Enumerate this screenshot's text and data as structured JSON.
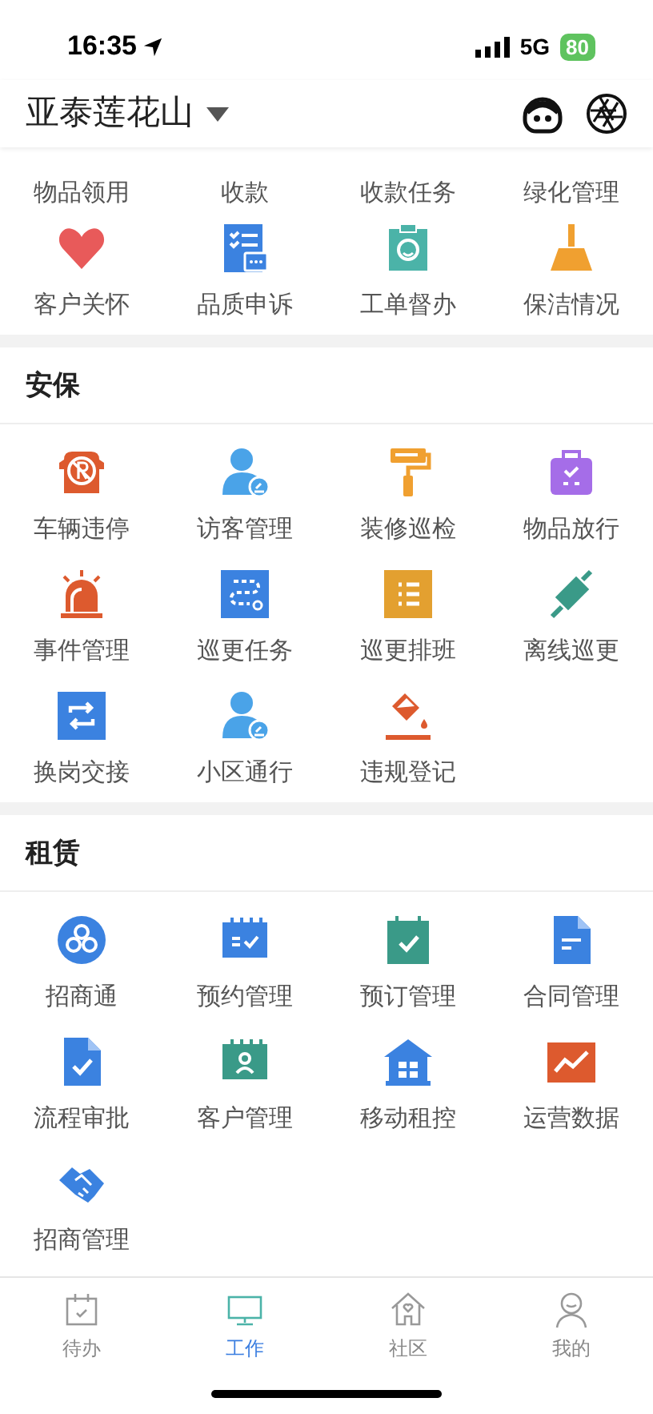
{
  "status_bar": {
    "time": "16:35",
    "network": "5G",
    "battery": "80"
  },
  "header": {
    "title": "亚泰莲花山"
  },
  "top_items": [
    {
      "label": "物品领用"
    },
    {
      "label": "收款"
    },
    {
      "label": "收款任务"
    },
    {
      "label": "绿化管理"
    }
  ],
  "top_grid": [
    {
      "label": "客户关怀"
    },
    {
      "label": "品质申诉"
    },
    {
      "label": "工单督办"
    },
    {
      "label": "保洁情况"
    }
  ],
  "sections": [
    {
      "title": "安保",
      "items": [
        {
          "label": "车辆违停"
        },
        {
          "label": "访客管理"
        },
        {
          "label": "装修巡检"
        },
        {
          "label": "物品放行"
        },
        {
          "label": "事件管理"
        },
        {
          "label": "巡更任务"
        },
        {
          "label": "巡更排班"
        },
        {
          "label": "离线巡更"
        },
        {
          "label": "换岗交接"
        },
        {
          "label": "小区通行"
        },
        {
          "label": "违规登记"
        }
      ]
    },
    {
      "title": "租赁",
      "items": [
        {
          "label": "招商通"
        },
        {
          "label": "预约管理"
        },
        {
          "label": "预订管理"
        },
        {
          "label": "合同管理"
        },
        {
          "label": "流程审批"
        },
        {
          "label": "客户管理"
        },
        {
          "label": "移动租控"
        },
        {
          "label": "运营数据"
        },
        {
          "label": "招商管理"
        }
      ]
    }
  ],
  "tab_bar": [
    {
      "label": "待办",
      "selected": false
    },
    {
      "label": "工作",
      "selected": true
    },
    {
      "label": "社区",
      "selected": false
    },
    {
      "label": "我的",
      "selected": false
    }
  ]
}
